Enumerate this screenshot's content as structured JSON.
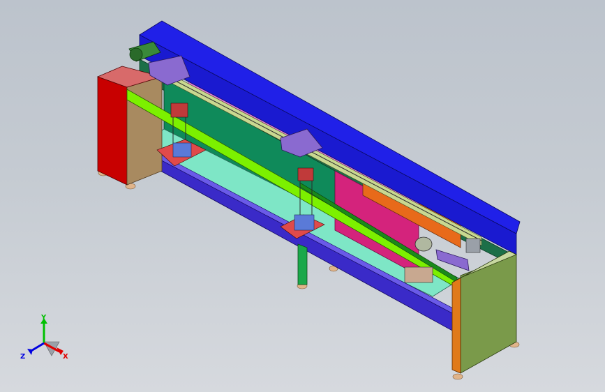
{
  "viewport": {
    "background_top": "#bcc3cc",
    "background_bottom": "#d6d9de"
  },
  "model": {
    "type": "conveyor machine assembly",
    "colors": {
      "top_cover": "#2020d8",
      "left_leg": "#c80000",
      "right_leg": "#7a9a4a",
      "green_rail": "#7cf000",
      "back_panel": "#0f8a5a",
      "tray": "#7ee6c6",
      "base_beam": "#3a2ac8",
      "magenta_panel": "#d4237c",
      "orange_panel": "#e86a1a",
      "purple_carriage": "#8a6ad0"
    }
  },
  "triad": {
    "y_label": "Y",
    "x_label": "X",
    "z_label": "Z",
    "y_color": "#00c000",
    "x_color": "#e00000",
    "z_color": "#0000e0"
  }
}
